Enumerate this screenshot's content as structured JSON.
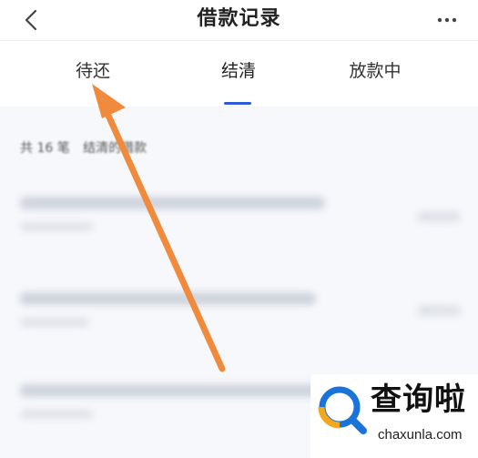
{
  "header": {
    "back_icon": "chevron-left-icon",
    "title": "借款记录",
    "more_icon": "more-horizontal-icon"
  },
  "tabs": [
    {
      "label": "待还",
      "active": false
    },
    {
      "label": "结清",
      "active": true
    },
    {
      "label": "放款中",
      "active": false
    }
  ],
  "summary": {
    "count_text": "共 16 笔",
    "desc_text": "结清的借款"
  },
  "annotation": {
    "arrow_color": "#f08a3c",
    "points_to": "待还"
  },
  "watermark": {
    "name": "查询啦",
    "domain": "chaxunla.com",
    "brand_colors": [
      "#1a73d9",
      "#f2a81d"
    ]
  },
  "colors": {
    "accent": "#2d5bd6",
    "background": "#f7f8fb"
  }
}
